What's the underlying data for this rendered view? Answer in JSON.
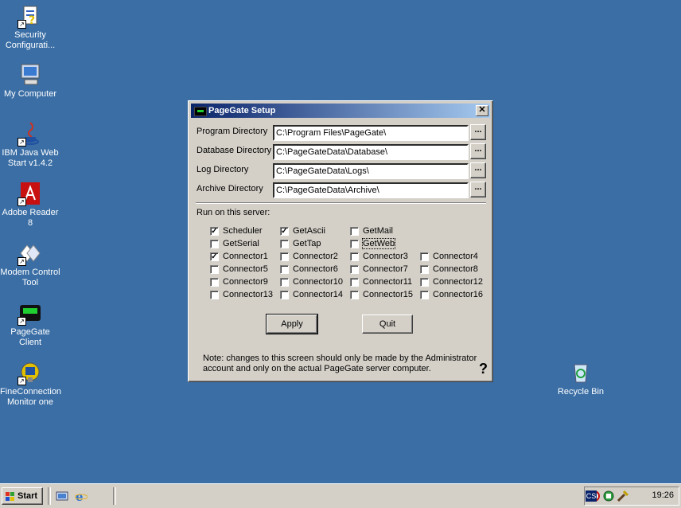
{
  "desktop": {
    "icons": [
      {
        "label": "Security\nConfigurati...",
        "icon": "security-config-icon"
      },
      {
        "label": "My Computer",
        "icon": "my-computer-icon"
      },
      {
        "label": "IBM Java Web\nStart v1.4.2",
        "icon": "java-icon"
      },
      {
        "label": "Adobe Reader\n8",
        "icon": "adobe-reader-icon"
      },
      {
        "label": "Modem Control\nTool",
        "icon": "modem-icon"
      },
      {
        "label": "PageGate\nClient",
        "icon": "pager-icon"
      },
      {
        "label": "FineConnection\nMonitor one",
        "icon": "monitor-icon"
      },
      {
        "label": "Recycle Bin",
        "icon": "recycle-bin-icon"
      }
    ]
  },
  "dialog": {
    "title": "PageGate Setup",
    "close_label": "✕",
    "fields": [
      {
        "label": "Program Directory",
        "value": "C:\\Program Files\\PageGate\\"
      },
      {
        "label": "Database Directory",
        "value": "C:\\PageGateData\\Database\\"
      },
      {
        "label": "Log Directory",
        "value": "C:\\PageGateData\\Logs\\"
      },
      {
        "label": "Archive Directory",
        "value": "C:\\PageGateData\\Archive\\"
      }
    ],
    "browse_label": "...",
    "run_label": "Run on this server:",
    "checkboxes": [
      {
        "label": "Scheduler",
        "checked": true
      },
      {
        "label": "GetAscii",
        "checked": true
      },
      {
        "label": "GetMail",
        "checked": false
      },
      {
        "label": "GetSerial",
        "checked": false
      },
      {
        "label": "GetTap",
        "checked": false
      },
      {
        "label": "GetWeb",
        "checked": false
      },
      {
        "label": "Connector1",
        "checked": true
      },
      {
        "label": "Connector2",
        "checked": false
      },
      {
        "label": "Connector3",
        "checked": false
      },
      {
        "label": "Connector4",
        "checked": false
      },
      {
        "label": "Connector5",
        "checked": false
      },
      {
        "label": "Connector6",
        "checked": false
      },
      {
        "label": "Connector7",
        "checked": false
      },
      {
        "label": "Connector8",
        "checked": false
      },
      {
        "label": "Connector9",
        "checked": false
      },
      {
        "label": "Connector10",
        "checked": false
      },
      {
        "label": "Connector11",
        "checked": false
      },
      {
        "label": "Connector12",
        "checked": false
      },
      {
        "label": "Connector13",
        "checked": false
      },
      {
        "label": "Connector14",
        "checked": false
      },
      {
        "label": "Connector15",
        "checked": false
      },
      {
        "label": "Connector16",
        "checked": false
      }
    ],
    "apply_label": "Apply",
    "quit_label": "Quit",
    "note": "Note: changes to this screen should only be made by the Administrator account and only on the actual PageGate server computer.",
    "help_label": "?"
  },
  "taskbar": {
    "start_label": "Start",
    "language": "CS",
    "clock": "19:26"
  },
  "colors": {
    "desktop": "#3a6ea5",
    "title_start": "#0a246a",
    "title_end": "#a6caf0",
    "face": "#d4d0c8"
  }
}
